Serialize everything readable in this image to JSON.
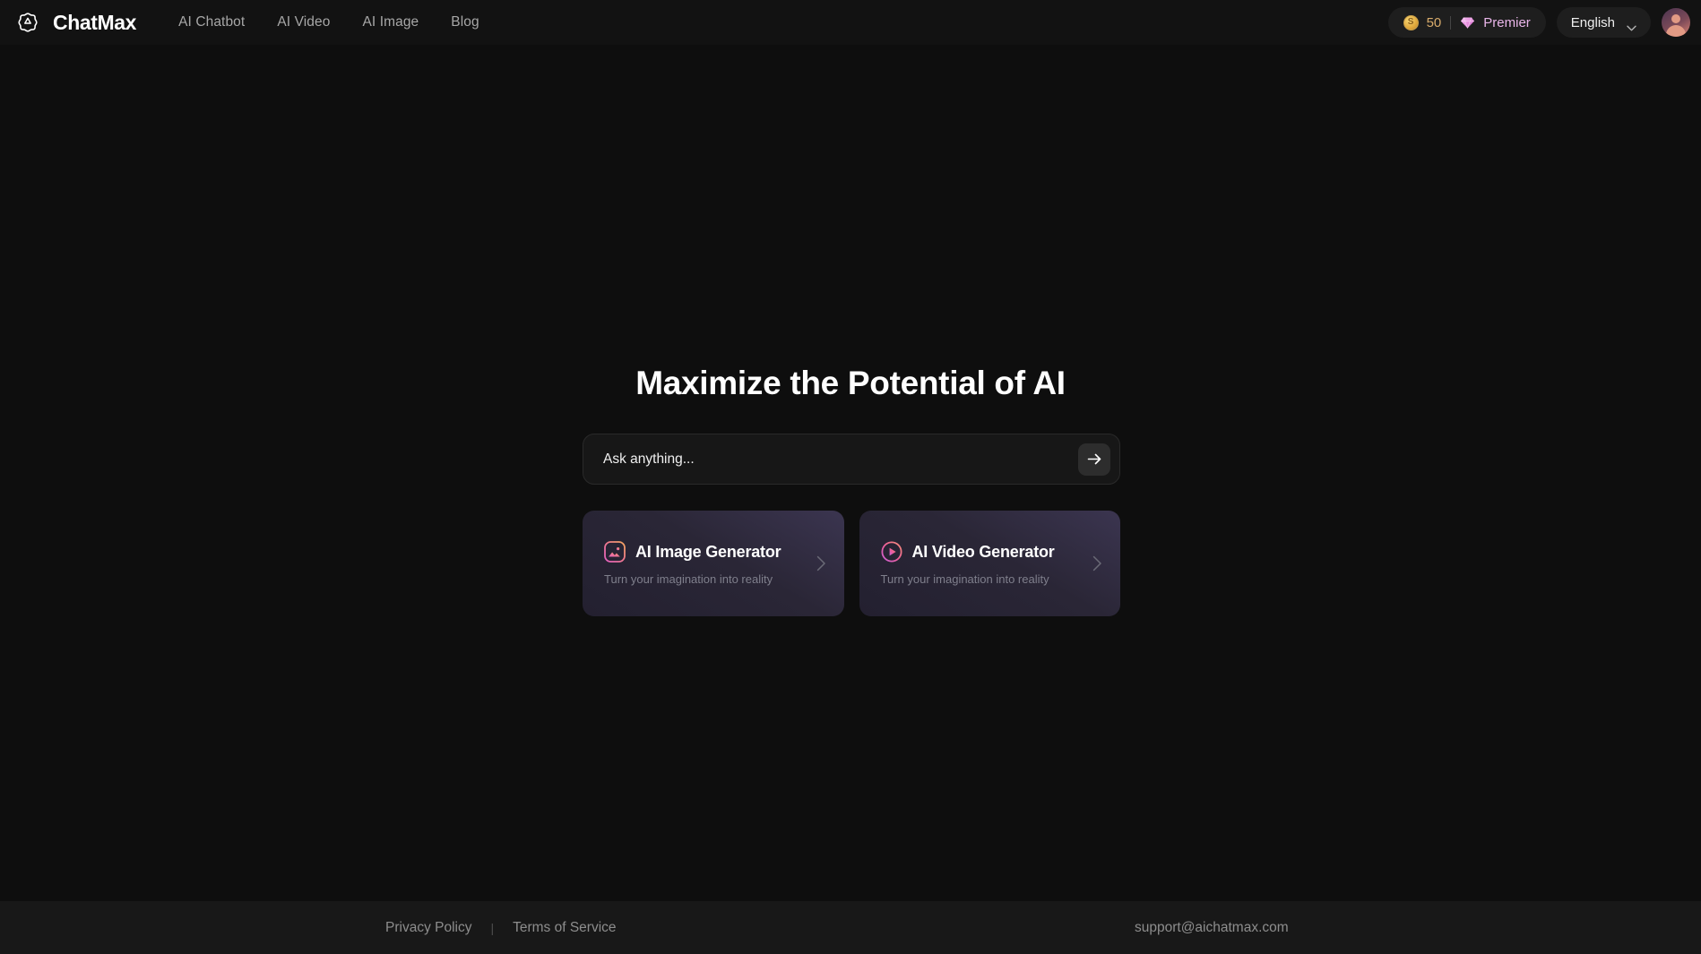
{
  "header": {
    "brand": {
      "name": "ChatMax",
      "logo_icon": "flower-gear-logo-icon"
    },
    "nav": [
      {
        "label": "AI Chatbot",
        "name": "nav-ai-chatbot"
      },
      {
        "label": "AI Video",
        "name": "nav-ai-video"
      },
      {
        "label": "AI Image",
        "name": "nav-ai-image"
      },
      {
        "label": "Blog",
        "name": "nav-blog"
      }
    ],
    "credits": {
      "coin_icon": "gold-coin-icon",
      "coin_glyph": "S",
      "value": "50",
      "gem_icon": "pink-diamond-icon",
      "plan_label": "Premier"
    },
    "language": {
      "label": "English",
      "chevron_icon": "chevron-down-icon"
    },
    "avatar": {
      "name": "user-avatar"
    }
  },
  "main": {
    "hero_title": "Maximize the Potential of AI",
    "ask": {
      "placeholder": "Ask anything...",
      "value": "",
      "submit_icon": "arrow-right-icon"
    },
    "cards": [
      {
        "title": "AI Image Generator",
        "subtitle": "Turn your imagination into reality",
        "icon": "image-generator-icon",
        "chevron_icon": "chevron-right-icon"
      },
      {
        "title": "AI Video Generator",
        "subtitle": "Turn your imagination into reality",
        "icon": "video-play-icon",
        "chevron_icon": "chevron-right-icon"
      }
    ]
  },
  "footer": {
    "privacy_label": "Privacy Policy",
    "separator": "|",
    "terms_label": "Terms of Service",
    "email": "support@aichatmax.com"
  },
  "colors": {
    "page_bg": "#0e0e0e",
    "header_bg": "#121212",
    "footer_bg": "#181818",
    "accent_gold": "#d8ab6b",
    "accent_pink": "#eab6ea",
    "card_gradient_from": "#3b3550",
    "card_gradient_to": "#232030"
  }
}
